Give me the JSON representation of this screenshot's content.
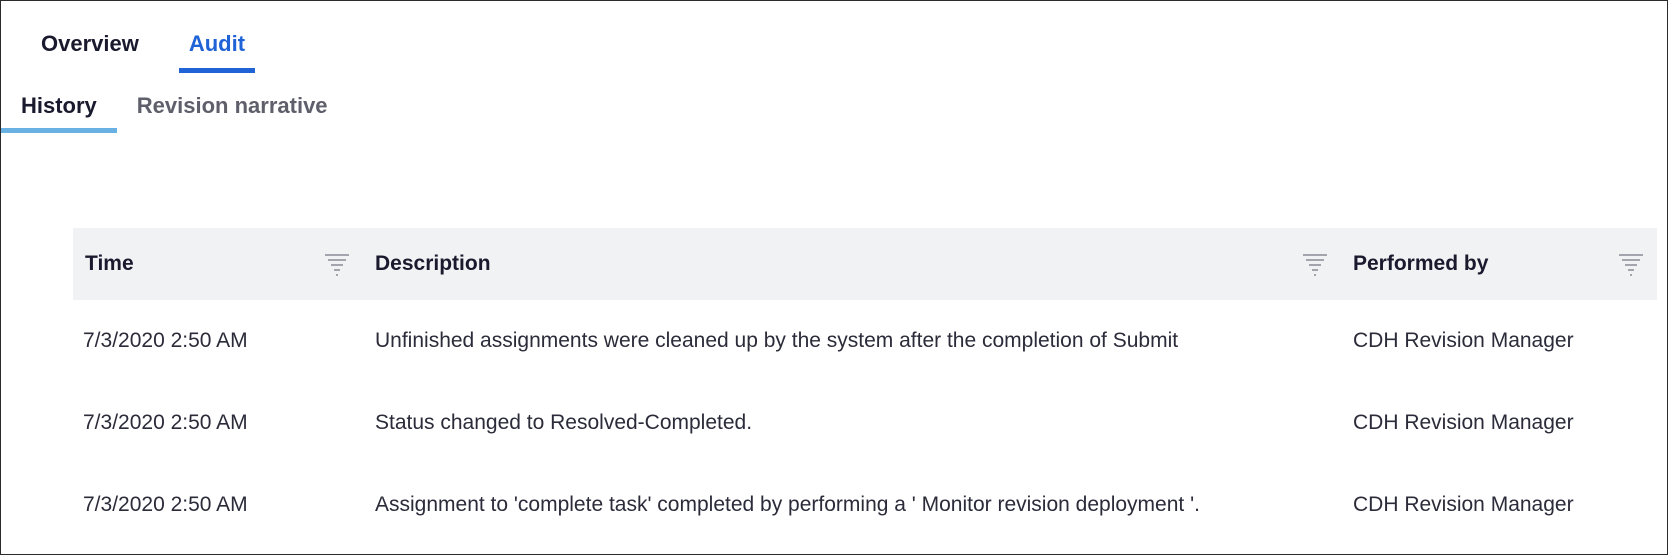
{
  "top_tabs": [
    {
      "label": "Overview",
      "active": false
    },
    {
      "label": "Audit",
      "active": true
    }
  ],
  "sub_tabs": [
    {
      "label": "History",
      "active": true
    },
    {
      "label": "Revision narrative",
      "active": false
    }
  ],
  "table": {
    "columns": [
      "Time",
      "Description",
      "Performed by"
    ],
    "rows": [
      {
        "time": "7/3/2020 2:50 AM",
        "description": "Unfinished assignments were cleaned up by the system after the completion of Submit",
        "performed_by": "CDH Revision Manager"
      },
      {
        "time": "7/3/2020 2:50 AM",
        "description": "Status changed to Resolved-Completed.",
        "performed_by": "CDH Revision Manager"
      },
      {
        "time": "7/3/2020 2:50 AM",
        "description": "Assignment to 'complete task' completed by performing a ' Monitor revision deployment '.",
        "performed_by": "CDH Revision Manager"
      }
    ]
  },
  "icons": {
    "column_filter": "filter-icon"
  },
  "colors": {
    "active_tab": "#1f63d6",
    "active_subtab_underline": "#6ab1e3",
    "table_header_bg": "#f1f2f4"
  }
}
